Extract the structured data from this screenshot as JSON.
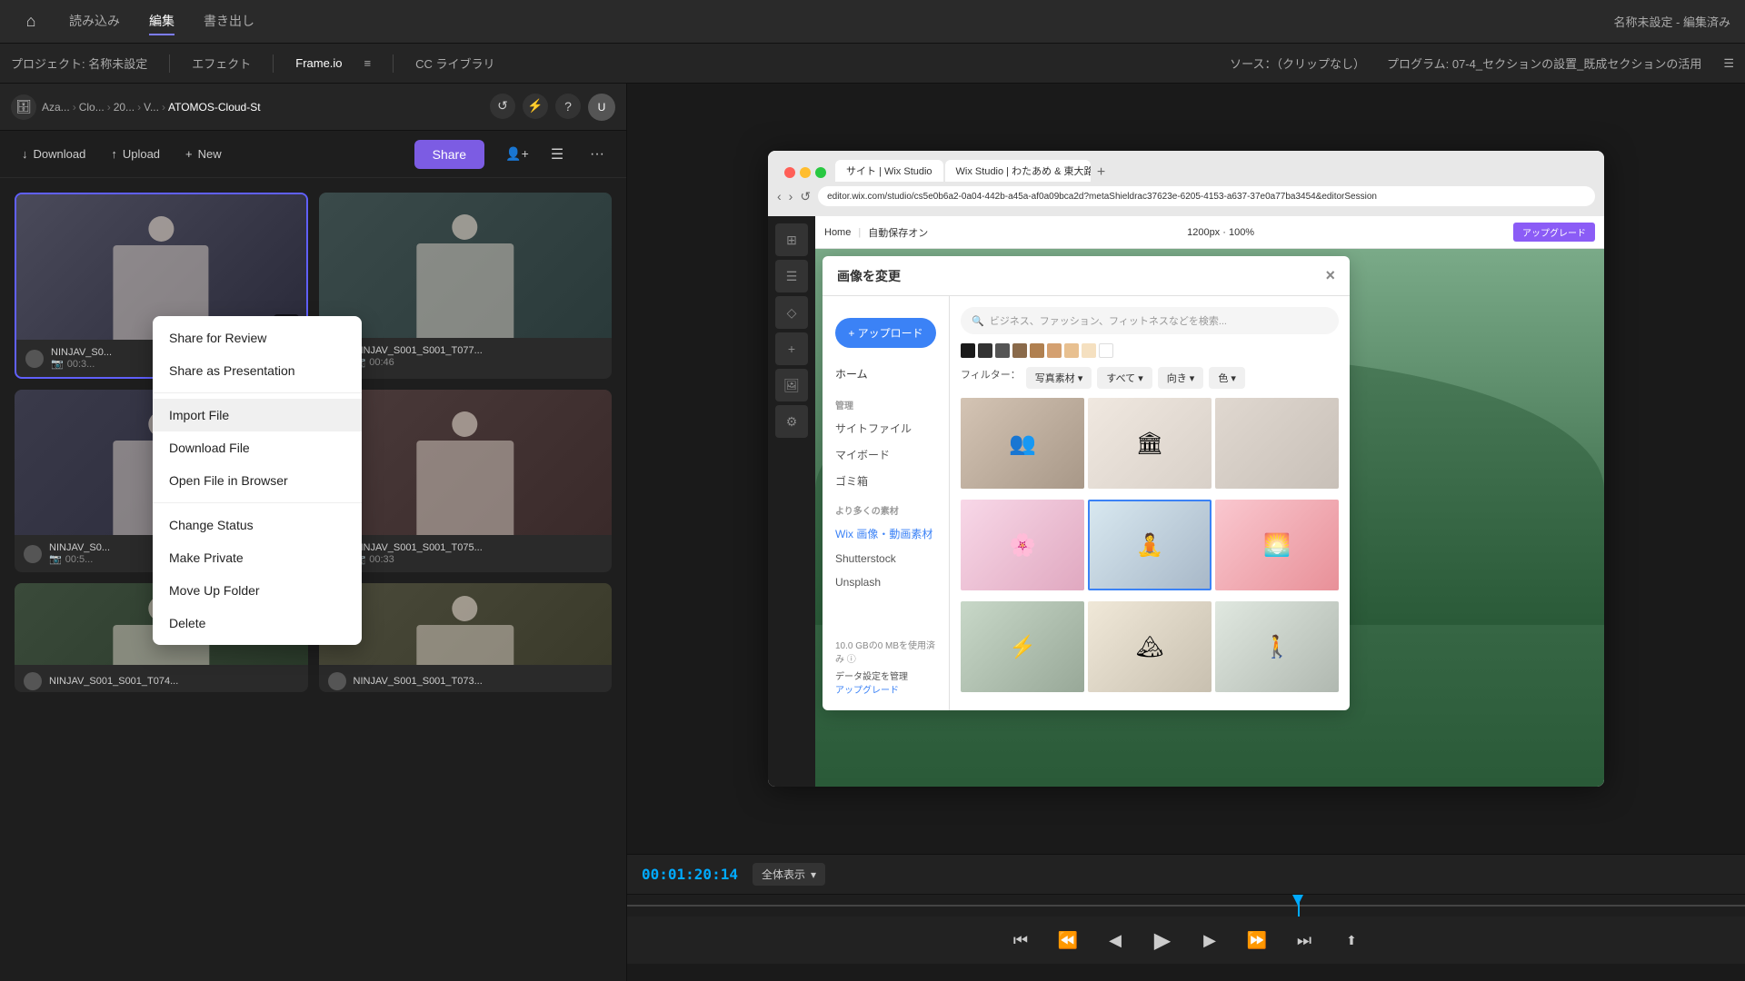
{
  "topnav": {
    "home_icon": "⌂",
    "items": [
      {
        "label": "読み込み",
        "active": false
      },
      {
        "label": "編集",
        "active": true
      },
      {
        "label": "書き出し",
        "active": false
      }
    ],
    "title": "名称未設定 - 編集済み"
  },
  "secondnav": {
    "items": [
      {
        "label": "プロジェクト: 名称未設定",
        "active": false
      },
      {
        "label": "エフェクト",
        "active": false
      },
      {
        "label": "Frame.io",
        "active": true
      },
      {
        "label": "≡",
        "active": false
      },
      {
        "label": "CC ライブラリ",
        "active": false
      }
    ],
    "source_label": "ソース：（クリップなし）",
    "program_label": "プログラム: 07-4_セクションの設置_既成セクションの活用",
    "program_icon": "☰"
  },
  "breadcrumb": {
    "storage_icon": "🗄",
    "items": [
      "Aza...",
      "Clo...",
      "20...",
      "V...",
      "ATOMOS-Cloud-St"
    ],
    "separators": [
      ">",
      ">",
      ">",
      ">"
    ],
    "refresh_icon": "↺",
    "lightning_icon": "⚡",
    "help_icon": "?",
    "avatar_initials": "U"
  },
  "actionbar": {
    "download_label": "Download",
    "download_icon": "↓",
    "upload_label": "Upload",
    "upload_icon": "↑",
    "new_label": "New",
    "new_icon": "+",
    "add_user_icon": "+👤",
    "share_label": "Share",
    "list_icon": "☰",
    "more_icon": "···"
  },
  "videos": [
    {
      "name": "NINJAV_S0...",
      "duration": "00:3...",
      "selected": true,
      "thumb_class": "thumb-1"
    },
    {
      "name": "NINJAV_S001_S001_T077...",
      "duration": "00:46",
      "selected": false,
      "thumb_class": "thumb-2"
    },
    {
      "name": "NINJAV_S0...",
      "duration": "00:5...",
      "selected": false,
      "thumb_class": "thumb-3"
    },
    {
      "name": "NINJAV_S001_S001_T075...",
      "duration": "00:33",
      "selected": false,
      "thumb_class": "thumb-4"
    },
    {
      "name": "NINJAV_S001_S001_T074...",
      "duration": "",
      "selected": false,
      "thumb_class": "thumb-5"
    },
    {
      "name": "NINJAV_S001_S001_T073...",
      "duration": "",
      "selected": false,
      "thumb_class": "thumb-6"
    }
  ],
  "context_menu": {
    "sections": [
      {
        "items": [
          {
            "label": "Share for Review",
            "highlighted": false
          },
          {
            "label": "Share as Presentation",
            "highlighted": false
          }
        ]
      },
      {
        "items": [
          {
            "label": "Import File",
            "highlighted": true
          },
          {
            "label": "Download File",
            "highlighted": false
          },
          {
            "label": "Open File in Browser",
            "highlighted": false
          }
        ]
      },
      {
        "items": [
          {
            "label": "Change Status",
            "highlighted": false
          },
          {
            "label": "Make Private",
            "highlighted": false
          },
          {
            "label": "Move Up Folder",
            "highlighted": false
          },
          {
            "label": "Delete",
            "highlighted": false
          }
        ]
      }
    ]
  },
  "browser": {
    "tab1_label": "サイト | Wix Studio",
    "tab2_label": "Wix Studio | わたあめ & 東大路",
    "url": "editor.wix.com/studio/cs5e0b6a2-0a04-442b-a45a-af0a09bca2d?metaShieldrac37623e-6205-4153-a637-37e0a77ba3454&editorSession",
    "topbar_home": "Home",
    "topbar_autosave": "自動保存オン",
    "zoom": "1200px · 100%",
    "upgrade_btn": "アップグレード"
  },
  "wix_dialog": {
    "title": "画像を変更",
    "upload_btn": "+ アップロード",
    "search_placeholder": "ビジネス、ファッション、フィットネスなどを検索...",
    "sidebar_items": [
      {
        "label": "ホーム",
        "active": false,
        "type": "main"
      },
      {
        "label": "管理",
        "type": "section"
      },
      {
        "label": "サイトファイル",
        "active": false,
        "type": "sub"
      },
      {
        "label": "マイボード",
        "active": false,
        "type": "sub"
      },
      {
        "label": "ゴミ箱",
        "active": false,
        "type": "sub"
      },
      {
        "label": "より多くの素材",
        "type": "section"
      },
      {
        "label": "Wix 画像・動画素材",
        "active": true,
        "type": "sub"
      },
      {
        "label": "Shutterstock",
        "active": false,
        "type": "sub"
      },
      {
        "label": "Unsplash",
        "active": false,
        "type": "sub"
      }
    ],
    "filters": [
      "フィルター：",
      "写真素材 ▾",
      "すべて ▾",
      "向き ▾",
      "色 ▾"
    ],
    "storage_info": "10.0 GBの0 MBを使用済み ⓘ",
    "upgrade_link": "アップグレード",
    "data_link": "データ設定を管理"
  },
  "timeline": {
    "timecode": "00:01:20:14",
    "view_label": "全体表示",
    "chevron": "▾"
  },
  "swatches": [
    "#1a1a1a",
    "#333333",
    "#555555",
    "#8a6a4a",
    "#b08050",
    "#d4a070",
    "#e8c090",
    "#f5e0c0",
    "#ffffff",
    "#e8e8e8",
    "#d0d0d0"
  ]
}
